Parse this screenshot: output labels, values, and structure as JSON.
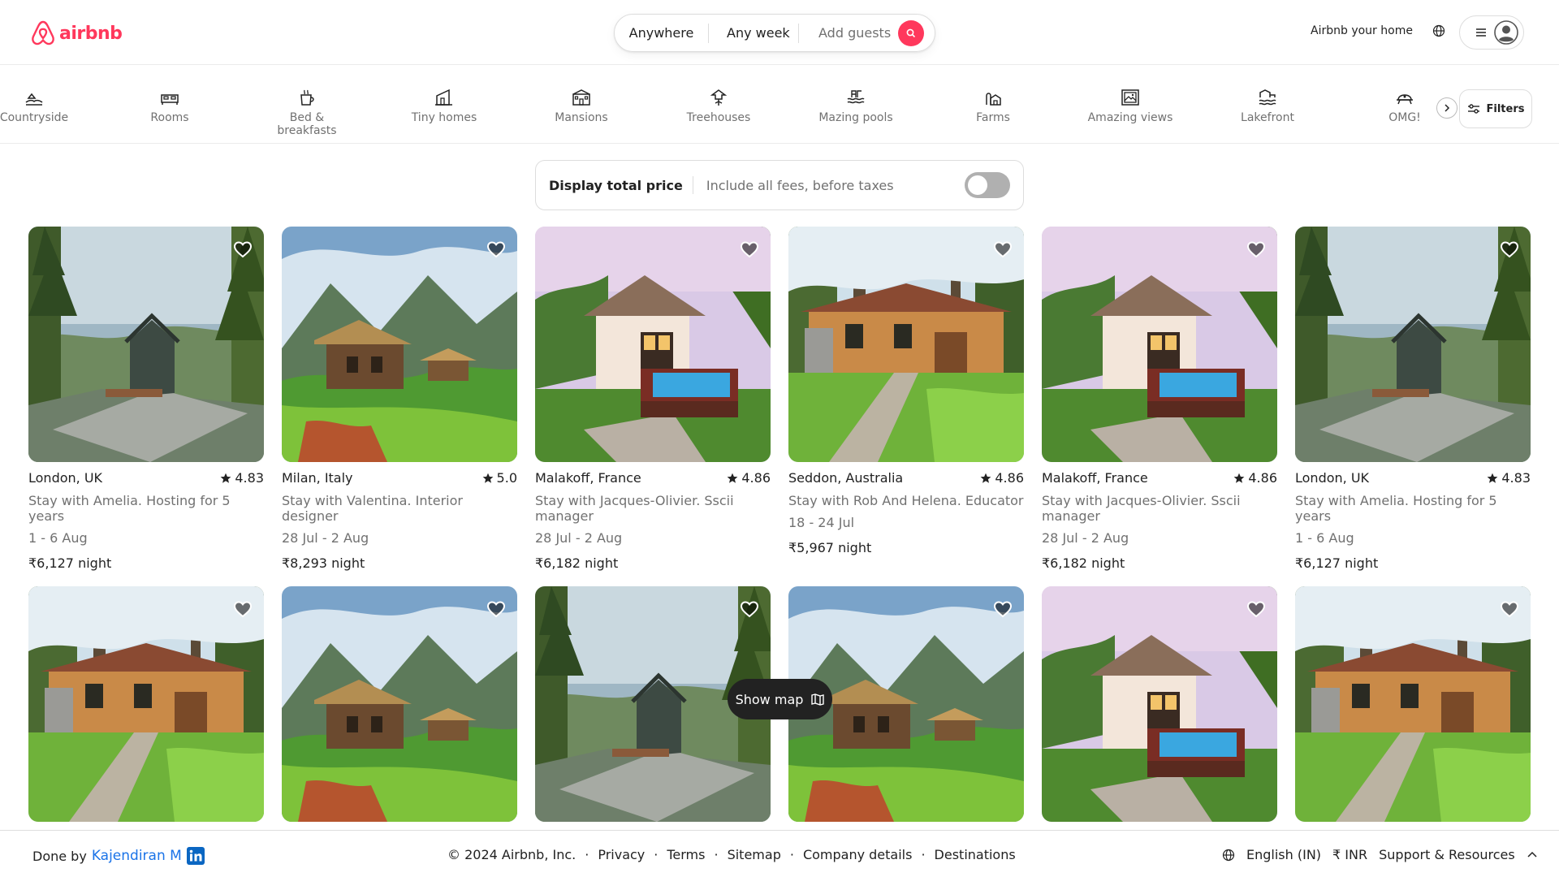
{
  "header": {
    "logo_text": "airbnb",
    "brand_color": "#ff385c",
    "search": {
      "anywhere": "Anywhere",
      "week": "Any week",
      "guests": "Add guests"
    },
    "host_link": "Airbnb your home"
  },
  "categories": [
    {
      "label": "Countryside",
      "icon": "countryside-icon"
    },
    {
      "label": "Rooms",
      "icon": "rooms-icon"
    },
    {
      "label": "Bed & breakfasts",
      "icon": "bed-breakfast-icon"
    },
    {
      "label": "Tiny homes",
      "icon": "tiny-home-icon"
    },
    {
      "label": "Mansions",
      "icon": "mansion-icon"
    },
    {
      "label": "Treehouses",
      "icon": "treehouse-icon"
    },
    {
      "label": "Mazing pools",
      "icon": "pool-icon"
    },
    {
      "label": "Farms",
      "icon": "farm-icon"
    },
    {
      "label": "Amazing views",
      "icon": "view-icon"
    },
    {
      "label": "Lakefront",
      "icon": "lakefront-icon"
    },
    {
      "label": "OMG!",
      "icon": "omg-icon"
    }
  ],
  "filters_label": "Filters",
  "price_toggle": {
    "label": "Display total price",
    "sub": "Include all fees, before taxes",
    "enabled": false
  },
  "listings": [
    {
      "location": "London, UK",
      "rating": "4.83",
      "desc": "Stay with Amelia. Hosting for 5 years",
      "dates": "1 - 6 Aug",
      "price": "₹6,127",
      "unit": "night",
      "photo": "cabin"
    },
    {
      "location": "Milan, Italy",
      "rating": "5.0",
      "desc": "Stay with Valentina. Interior designer",
      "dates": "28 Jul - 2 Aug",
      "price": "₹8,293",
      "unit": "night",
      "photo": "hut"
    },
    {
      "location": "Malakoff, France",
      "rating": "4.86",
      "desc": "Stay with Jacques-Olivier. Sscii manager",
      "dates": "28 Jul - 2 Aug",
      "price": "₹6,182",
      "unit": "night",
      "photo": "pool"
    },
    {
      "location": "Seddon, Australia",
      "rating": "4.86",
      "desc": "Stay with Rob And Helena. Educator",
      "dates": "18 - 24 Jul",
      "price": "₹5,967",
      "unit": "night",
      "photo": "cottage"
    },
    {
      "location": "Malakoff, France",
      "rating": "4.86",
      "desc": "Stay with Jacques-Olivier. Sscii manager",
      "dates": "28 Jul - 2 Aug",
      "price": "₹6,182",
      "unit": "night",
      "photo": "pool"
    },
    {
      "location": "London, UK",
      "rating": "4.83",
      "desc": "Stay with Amelia. Hosting for 5 years",
      "dates": "1 - 6 Aug",
      "price": "₹6,127",
      "unit": "night",
      "photo": "cabin"
    },
    {
      "photo": "cottage"
    },
    {
      "photo": "hut"
    },
    {
      "photo": "cabin"
    },
    {
      "photo": "hut"
    },
    {
      "photo": "pool"
    },
    {
      "photo": "cottage"
    }
  ],
  "show_map": "Show map",
  "footer": {
    "done_by": "Done by",
    "author": "Kajendiran M",
    "copyright": "© 2024 Airbnb, Inc.",
    "links": [
      "Privacy",
      "Terms",
      "Sitemap",
      "Company details",
      "Destinations"
    ],
    "language": "English (IN)",
    "currency": "₹ INR",
    "support": "Support & Resources"
  }
}
